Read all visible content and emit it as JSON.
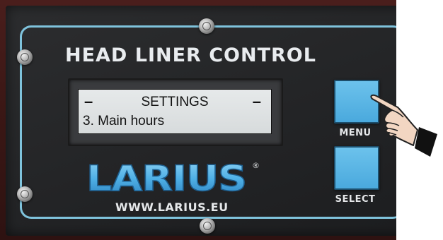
{
  "panel": {
    "title": "HEAD LINER CONTROL",
    "website": "WWW.LARIUS.EU"
  },
  "lcd": {
    "line1": "SETTINGS",
    "line1_left_marker": "–",
    "line1_right_marker": "–",
    "line2": "3. Main hours"
  },
  "logo": {
    "text": "LARIUS",
    "registered_mark": "®",
    "color": "#4fb0e6"
  },
  "buttons": {
    "menu_label": "MENU",
    "select_label": "SELECT"
  },
  "colors": {
    "accent_blue": "#5bb8e8",
    "outline": "#7fc3dc",
    "frame_red": "#3b1715",
    "faceplate": "#232426"
  },
  "icons": {
    "pointer": "pointing-hand-icon",
    "screw": "screw-icon"
  }
}
